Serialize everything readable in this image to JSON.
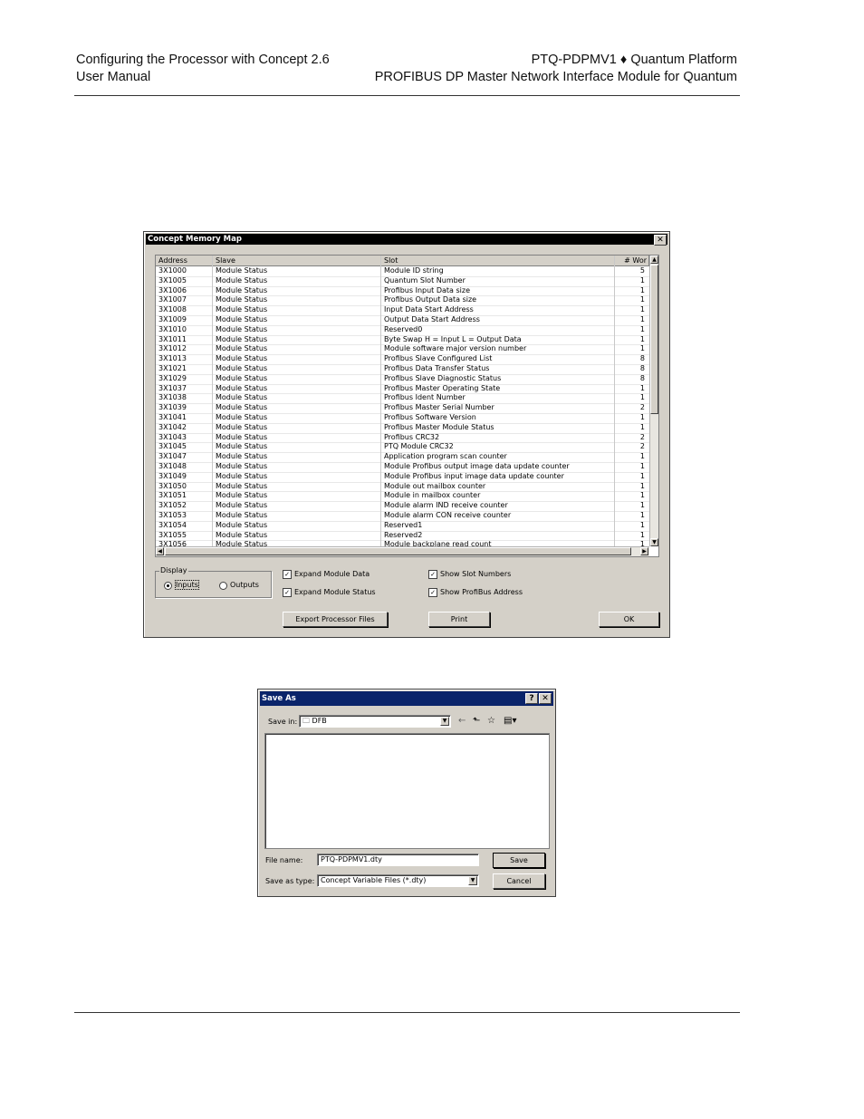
{
  "header": {
    "left_line1": "Configuring the Processor with Concept 2.6",
    "left_line2": "User Manual",
    "right_line1": "PTQ-PDPMV1 ♦ Quantum Platform",
    "right_line2": "PROFIBUS DP Master Network Interface Module for Quantum"
  },
  "memory_map": {
    "title": "Concept Memory Map",
    "close_glyph": "✕",
    "columns": [
      "Address",
      "Slave",
      "Slot",
      "# Wor"
    ],
    "rows": [
      [
        "3X1000",
        "Module Status",
        "Module ID string",
        "5"
      ],
      [
        "3X1005",
        "Module Status",
        "Quantum Slot Number",
        "1"
      ],
      [
        "3X1006",
        "Module Status",
        "Profibus Input Data size",
        "1"
      ],
      [
        "3X1007",
        "Module Status",
        "Profibus Output Data size",
        "1"
      ],
      [
        "3X1008",
        "Module Status",
        "Input Data Start Address",
        "1"
      ],
      [
        "3X1009",
        "Module Status",
        "Output Data Start Address",
        "1"
      ],
      [
        "3X1010",
        "Module Status",
        "Reserved0",
        "1"
      ],
      [
        "3X1011",
        "Module Status",
        "Byte Swap H = Input L = Output Data",
        "1"
      ],
      [
        "3X1012",
        "Module Status",
        "Module software major version number",
        "1"
      ],
      [
        "3X1013",
        "Module Status",
        "Profibus Slave Configured List",
        "8"
      ],
      [
        "3X1021",
        "Module Status",
        "Profibus Data Transfer Status",
        "8"
      ],
      [
        "3X1029",
        "Module Status",
        "Profibus Slave Diagnostic Status",
        "8"
      ],
      [
        "3X1037",
        "Module Status",
        "Profibus Master Operating State",
        "1"
      ],
      [
        "3X1038",
        "Module Status",
        "Profibus Ident Number",
        "1"
      ],
      [
        "3X1039",
        "Module Status",
        "Profibus Master Serial Number",
        "2"
      ],
      [
        "3X1041",
        "Module Status",
        "Profibus Software Version",
        "1"
      ],
      [
        "3X1042",
        "Module Status",
        "Profibus Master Module Status",
        "1"
      ],
      [
        "3X1043",
        "Module Status",
        "Profibus CRC32",
        "2"
      ],
      [
        "3X1045",
        "Module Status",
        "PTQ Module CRC32",
        "2"
      ],
      [
        "3X1047",
        "Module Status",
        "Application program scan counter",
        "1"
      ],
      [
        "3X1048",
        "Module Status",
        "Module Profibus output image data update counter",
        "1"
      ],
      [
        "3X1049",
        "Module Status",
        "Module Profibus input image data update counter",
        "1"
      ],
      [
        "3X1050",
        "Module Status",
        "Module out mailbox counter",
        "1"
      ],
      [
        "3X1051",
        "Module Status",
        "Module in mailbox counter",
        "1"
      ],
      [
        "3X1052",
        "Module Status",
        "Module alarm IND receive counter",
        "1"
      ],
      [
        "3X1053",
        "Module Status",
        "Module alarm CON receive counter",
        "1"
      ],
      [
        "3X1054",
        "Module Status",
        "Reserved1",
        "1"
      ],
      [
        "3X1055",
        "Module Status",
        "Reserved2",
        "1"
      ],
      [
        "3X1056",
        "Module Status",
        "Module backplane read count",
        "1"
      ]
    ],
    "display_group": "Display",
    "radio_inputs": "Inputs",
    "radio_outputs": "Outputs",
    "chk_expand_data": "Expand Module Data",
    "chk_expand_status": "Expand Module Status",
    "chk_slot_numbers": "Show Slot Numbers",
    "chk_profibus_address": "Show ProfiBus Address",
    "btn_export": "Export Processor Files",
    "btn_print": "Print",
    "btn_ok": "OK",
    "up_glyph": "▲",
    "down_glyph": "▼",
    "left_glyph": "◀",
    "right_glyph": "▶"
  },
  "save_as": {
    "title": "Save As",
    "help_glyph": "?",
    "close_glyph": "✕",
    "save_in_label": "Save in:",
    "save_in_value": "DFB",
    "folder_glyph": "🗀",
    "toolbar_back": "←",
    "toolbar_up": "⬑",
    "toolbar_new": "☆",
    "toolbar_view": "▤▾",
    "file_name_label": "File name:",
    "file_name_value": "PTQ-PDPMV1.dty",
    "save_type_label": "Save as type:",
    "save_type_value": "Concept Variable Files (*.dty)",
    "btn_save": "Save",
    "btn_cancel": "Cancel",
    "dd_glyph": "▼"
  }
}
